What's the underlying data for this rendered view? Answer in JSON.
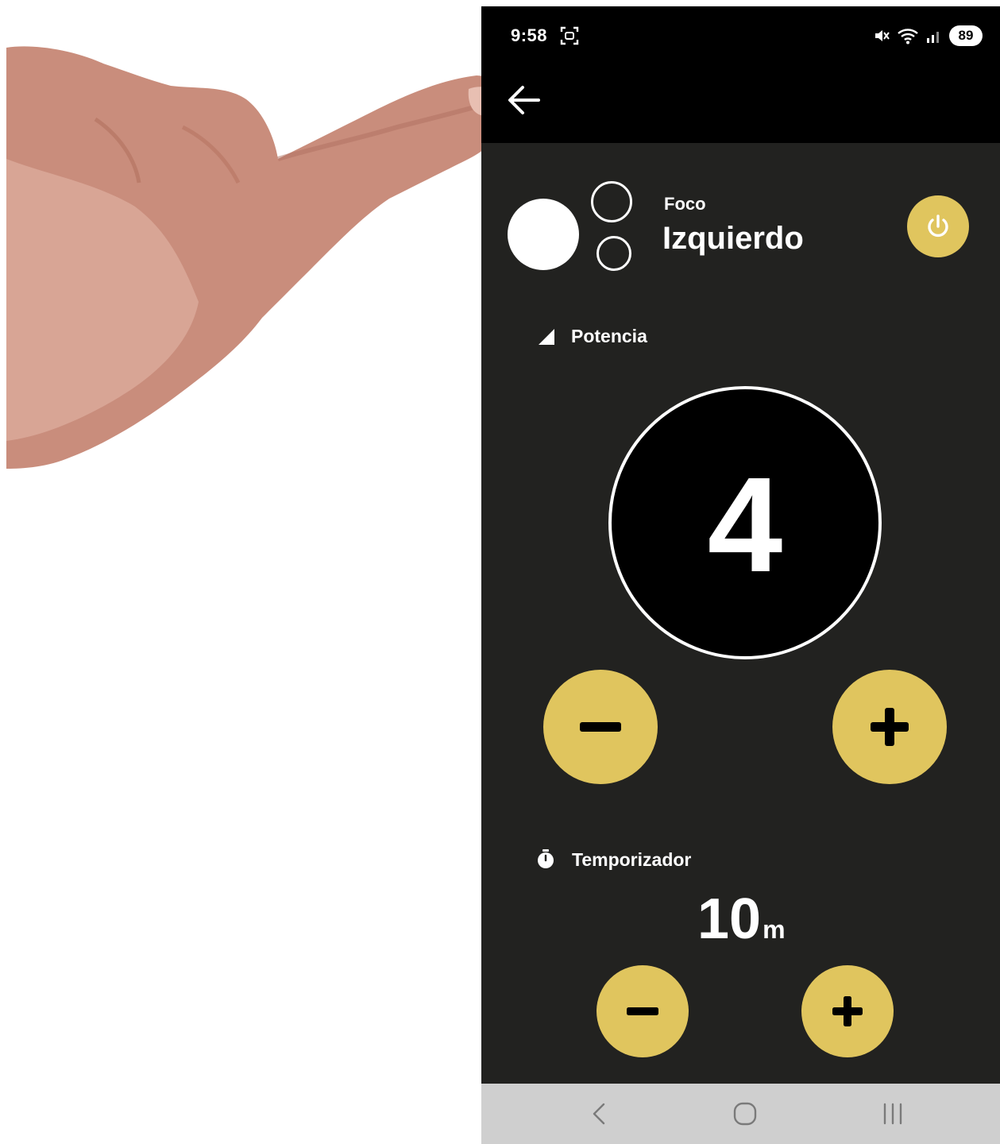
{
  "status_bar": {
    "time": "9:58",
    "battery": "89",
    "icons": [
      "screenshot-icon",
      "mute-icon",
      "wifi-icon",
      "signal-icon"
    ]
  },
  "app_bar": {
    "back_icon": "back-arrow-icon"
  },
  "device": {
    "type_label": "Foco",
    "name": "Izquierdo",
    "power_icon": "power-icon"
  },
  "power": {
    "label": "Potencia",
    "value": "4"
  },
  "timer": {
    "label": "Temporizador",
    "value": "10",
    "unit": "m"
  },
  "nav": {
    "icons": [
      "nav-back-icon",
      "nav-home-icon",
      "nav-recents-icon"
    ]
  },
  "colors": {
    "accent": "#e0c55e",
    "background": "#222220",
    "bar": "#000000",
    "nav": "#cfcfcf"
  }
}
